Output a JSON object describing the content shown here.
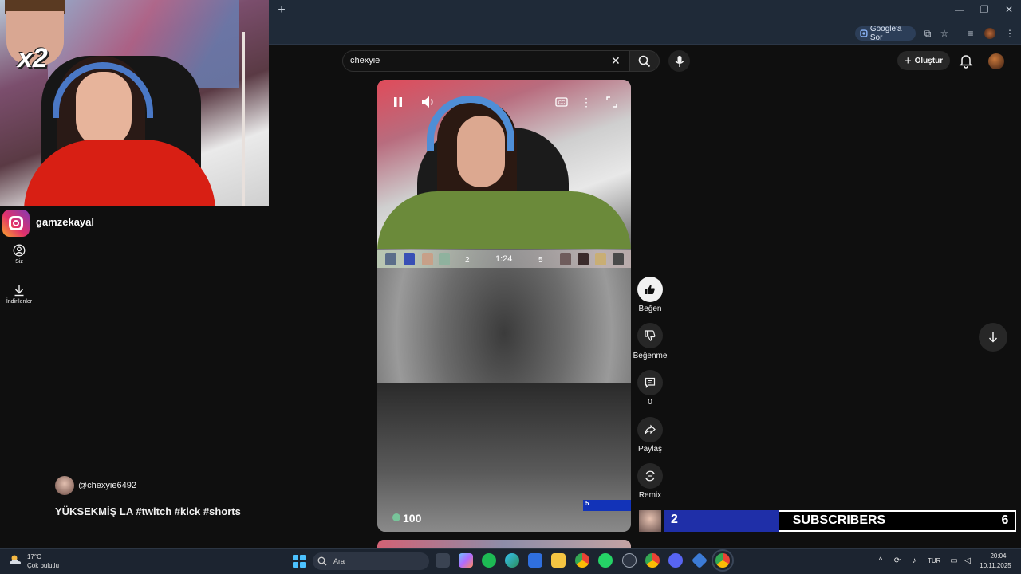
{
  "browser": {
    "google_sor_label": "Google'a Sor",
    "window_controls": [
      "—",
      "❐",
      "✕"
    ]
  },
  "search": {
    "query": "chexyie",
    "clear_icon": "close-icon",
    "search_icon": "search-icon",
    "mic_icon": "mic-icon"
  },
  "header": {
    "create_label": "Oluştur",
    "create_plus": "+"
  },
  "overlay": {
    "multiplier": "x2",
    "insta_handle": "gamzekayal"
  },
  "sidebar": {
    "items": [
      {
        "label": "Siz",
        "icon": "account-icon"
      },
      {
        "label": "İndirilenler",
        "icon": "download-icon"
      }
    ]
  },
  "video": {
    "hud_left_score": "2",
    "hud_timer": "1:24",
    "hud_right_score": "5",
    "health": "100",
    "ammo_box": "5"
  },
  "actions": {
    "like_label": "Beğen",
    "dislike_label": "Beğenme",
    "comments_count": "0",
    "share_label": "Paylaş",
    "remix_label": "Remix"
  },
  "channel": {
    "name": "@chexyie6492",
    "title": "YÜKSEKMİŞ LA #twitch #kick #shorts"
  },
  "subscribers": {
    "count": "2",
    "label": "SUBSCRIBERS",
    "goal": "6"
  },
  "taskbar": {
    "weather_temp": "17°C",
    "weather_desc": "Çok bulutlu",
    "search_placeholder": "Ara",
    "language": "TUR",
    "time": "20:04",
    "date": "10.11.2025"
  },
  "colors": {
    "accent_blue": "#1f2fa8",
    "win_blue": "#4cc2ff"
  }
}
